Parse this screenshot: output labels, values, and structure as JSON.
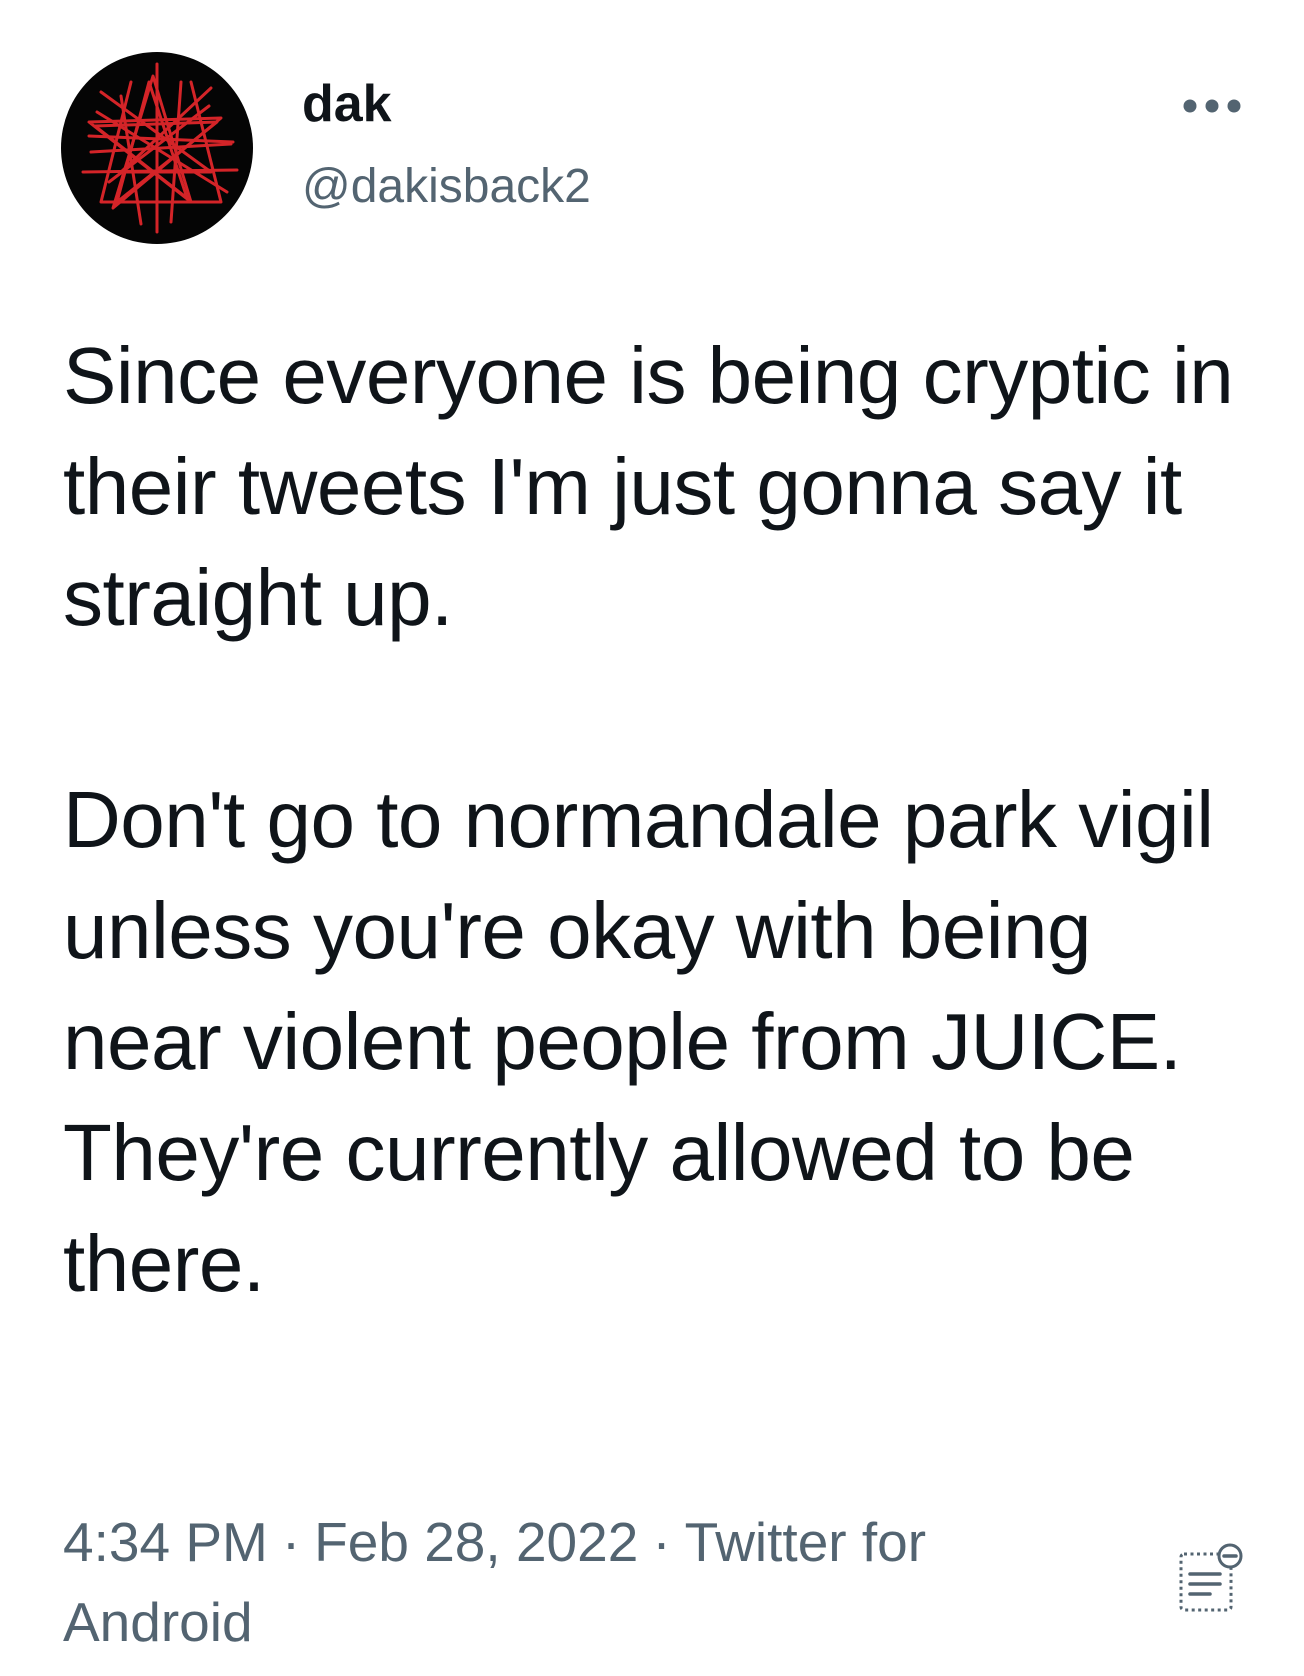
{
  "author": {
    "display_name": "dak",
    "handle": "@dakisback2",
    "avatar_icon": "red-scribbled-star-avatar"
  },
  "tweet": {
    "paragraphs": [
      "Since everyone is being cryptic in their tweets I'm just gonna say it straight up.",
      "Don't go to normandale park vigil unless you're okay with being near violent people from JUICE. They're currently allowed to be there."
    ]
  },
  "meta": {
    "time": "4:34 PM",
    "separator": "·",
    "date": "Feb 28, 2022",
    "source": "Twitter for Android"
  },
  "icons": {
    "more": "more-horizontal-icon",
    "notes": "community-notes-icon"
  },
  "colors": {
    "text_primary": "#0f1419",
    "text_secondary": "#536471",
    "avatar_bg": "#050505",
    "avatar_scribble": "#e0262b"
  }
}
